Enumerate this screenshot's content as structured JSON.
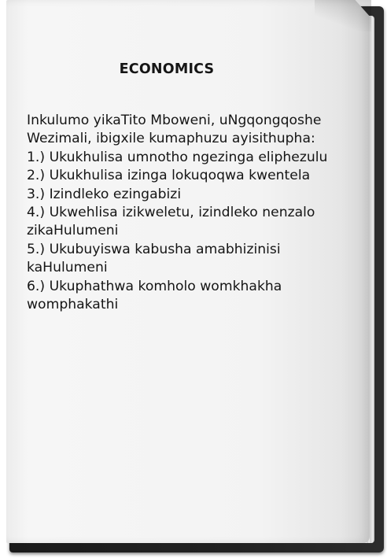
{
  "document": {
    "title": "ECONOMICS",
    "lines": [
      "Inkulumo yikaTito Mboweni, uNgqongqoshe",
      "Wezimali, ibigxile kumaphuzu ayisithupha:",
      "1.) Ukukhulisa umnotho ngezinga eliphezulu",
      "2.) Ukukhulisa izinga lokuqoqwa kwentela",
      "3.) Izindleko ezingabizi",
      "4.) Ukwehlisa izikweletu, izindleko nenzalo",
      "zikaHulumeni",
      "5.) Ukubuyiswa kabusha amabhizinisi",
      "kaHulumeni",
      "6.) Ukuphathwa komholo womkhakha",
      "womphakathi"
    ]
  }
}
